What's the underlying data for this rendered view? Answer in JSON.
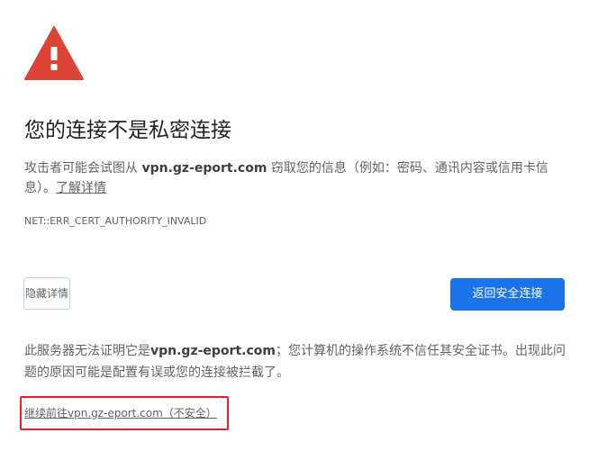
{
  "interstitial": {
    "icon": "warning-triangle-icon",
    "colors": {
      "warning_red": "#db4437",
      "primary_blue": "#1a73e8",
      "highlight_border": "#e02424"
    },
    "title": "您的连接不是私密连接",
    "description": {
      "prefix": "攻击者可能会试图从 ",
      "host": "vpn.gz-eport.com",
      "suffix": " 窃取您的信息（例如：密码、通讯内容或信用卡信息）。",
      "learn_more": "了解详情"
    },
    "error_code": "NET::ERR_CERT_AUTHORITY_INVALID",
    "buttons": {
      "hide_details": "隐藏详情",
      "back_to_safety": "返回安全连接"
    },
    "details": {
      "prefix": "此服务器无法证明它是",
      "host": "vpn.gz-eport.com",
      "suffix": "；您计算机的操作系统不信任其安全证书。出现此问题的原因可能是配置有误或您的连接被拦截了。"
    },
    "proceed_link": "继续前往vpn.gz-eport.com（不安全）"
  }
}
